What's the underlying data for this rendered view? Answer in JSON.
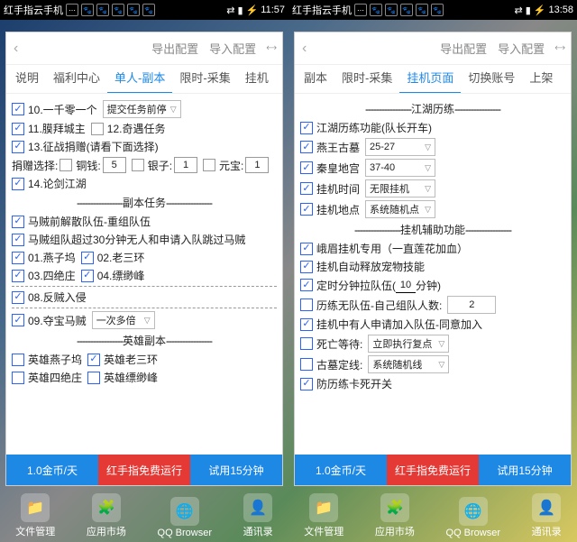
{
  "left": {
    "status": {
      "carrier": "红手指云手机",
      "time": "11:57"
    },
    "header": {
      "export": "导出配置",
      "import": "导入配置"
    },
    "tabs": [
      "说明",
      "福利中心",
      "单人-副本",
      "限时-采集",
      "挂机"
    ],
    "active_tab": 2,
    "c10": "10.一千零一个",
    "sel10": "提交任务前停",
    "c11": "11.膜拜城主",
    "c11b": "12.奇遇任务",
    "c13": "13.征战捐赠(请看下面选择)",
    "donate_label": "捐赠选择:",
    "d1": "铜钱:",
    "d1v": "5",
    "d2": "银子:",
    "d2v": "1",
    "d3": "元宝:",
    "d3v": "1",
    "c14": "14.论剑江湖",
    "div_sub": "副本任务",
    "s1": "马贼前解散队伍-重组队伍",
    "s2": "马贼组队超过30分钟无人和申请入队跳过马贼",
    "s3a": "01.燕子坞",
    "s3b": "02.老三环",
    "s4a": "03.四绝庄",
    "s4b": "04.缥缈峰",
    "s5": "08.反贼入侵",
    "s6": "09.夺宝马贼",
    "sel6": "一次多倍",
    "div_hero": "英雄副本",
    "h1a": "英雄燕子坞",
    "h1b": "英雄老三环",
    "h2a": "英雄四绝庄",
    "h2b": "英雄缥缈峰",
    "footer": {
      "a": "1.0金币/天",
      "b": "红手指免费运行",
      "c": "试用15分钟"
    },
    "dock": [
      "文件管理",
      "应用市场",
      "QQ Browser",
      "通讯录"
    ]
  },
  "right": {
    "status": {
      "carrier": "红手指云手机",
      "time": "13:58"
    },
    "header": {
      "export": "导出配置",
      "import": "导入配置"
    },
    "tabs": [
      "副本",
      "限时-采集",
      "挂机页面",
      "切换账号",
      "上架"
    ],
    "active_tab": 2,
    "div_jh": "江湖历练",
    "r1": "江湖历练功能(队长开车)",
    "r2": "燕王古墓",
    "sel2": "25-27",
    "r3": "秦皇地宫",
    "sel3": "37-40",
    "r4": "挂机时间",
    "sel4": "无限挂机",
    "r5": "挂机地点",
    "sel5": "系统随机点",
    "div_aux": "挂机辅助功能",
    "a1": "峨眉挂机专用（一直莲花加血）",
    "a2": "挂机自动释放宠物技能",
    "a3p": "定时分钟拉队伍(",
    "a3n": "10",
    "a3s": "分钟)",
    "a4p": "历练无队伍-自己组队人数:",
    "a4n": "2",
    "a5": "挂机中有人申请加入队伍-同意加入",
    "a6": "死亡等待:",
    "sel_a6": "立即执行复点",
    "a7": "古墓定线:",
    "sel_a7": "系统随机线",
    "a8": "防历练卡死开关",
    "footer": {
      "a": "1.0金币/天",
      "b": "红手指免费运行",
      "c": "试用15分钟"
    },
    "dock": [
      "文件管理",
      "应用市场",
      "QQ Browser",
      "通讯录"
    ]
  }
}
